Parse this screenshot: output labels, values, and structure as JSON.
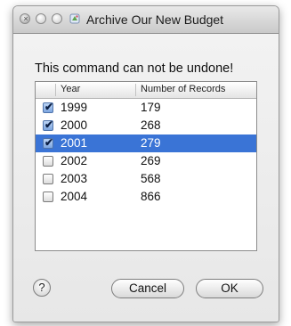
{
  "window": {
    "title": "Archive Our New Budget",
    "close_glyph": "×",
    "icons": [
      "close-icon",
      "minimize-icon",
      "zoom-icon",
      "app-icon"
    ]
  },
  "message": "This command can not be undone!",
  "table": {
    "columns": [
      "Year",
      "Number of Records"
    ],
    "rows": [
      {
        "year": "1999",
        "records": "179",
        "checked": true,
        "selected": false
      },
      {
        "year": "2000",
        "records": "268",
        "checked": true,
        "selected": false
      },
      {
        "year": "2001",
        "records": "279",
        "checked": true,
        "selected": true
      },
      {
        "year": "2002",
        "records": "269",
        "checked": false,
        "selected": false
      },
      {
        "year": "2003",
        "records": "568",
        "checked": false,
        "selected": false
      },
      {
        "year": "2004",
        "records": "866",
        "checked": false,
        "selected": false
      }
    ],
    "check_glyph": "✔"
  },
  "buttons": {
    "help_label": "?",
    "cancel_label": "Cancel",
    "ok_label": "OK"
  },
  "colors": {
    "selection": "#3a74d6"
  }
}
